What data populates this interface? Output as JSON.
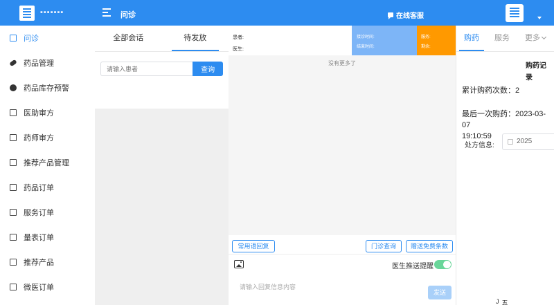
{
  "header": {
    "brand": "▪▪▪▪▪▪▪",
    "page_title": "问诊",
    "online_service": "在线客服"
  },
  "sidebar": {
    "items": [
      {
        "label": "问诊",
        "icon": "consult-icon",
        "active": true
      },
      {
        "label": "药品管理",
        "icon": "pill-icon"
      },
      {
        "label": "药品库存预警",
        "icon": "alert-icon"
      },
      {
        "label": "医助审方",
        "icon": "phone-icon"
      },
      {
        "label": "药师审方",
        "icon": "document-icon"
      },
      {
        "label": "推荐产品管理",
        "icon": "folder-icon"
      },
      {
        "label": "药品订单",
        "icon": "order-icon"
      },
      {
        "label": "服务订单",
        "icon": "service-order-icon"
      },
      {
        "label": "量表订单",
        "icon": "scale-order-icon"
      },
      {
        "label": "推荐产品",
        "icon": "product-icon"
      },
      {
        "label": "微医订单",
        "icon": "plus-order-icon"
      }
    ]
  },
  "conversations": {
    "tabs": [
      "全部会话",
      "待发放"
    ],
    "search_placeholder": "请输入患者",
    "search_button": "查询"
  },
  "chat": {
    "patient_label": "患者:",
    "doctor_label": "医生:",
    "start_time_label": "接诊时间:",
    "end_time_label": "结束时间:",
    "service_label": "服务:",
    "remaining_label": "剩余:",
    "no_more": "没有更多了",
    "quick_reply": "常用语回复",
    "outpatient_query": "门诊查询",
    "gift_free": "赠送免费条数",
    "push_reminder": "医生推送提醒",
    "reply_placeholder": "请输入回复信息内容",
    "send": "发送"
  },
  "right_panel": {
    "tabs": [
      "购药",
      "服务",
      "更多"
    ],
    "record_title": "购药记录",
    "total_count_label": "累计购药次数：",
    "total_count": "2",
    "last_purchase_label": "最后一次购药：",
    "last_purchase_date": "2023-03-07",
    "last_purchase_time": "19:10:59",
    "rx_label": "处方信息:",
    "rx_year": "2025"
  },
  "tools": {
    "tool_a": "J",
    "tool_b": "五"
  },
  "colors": {
    "primary": "#2d8cf0",
    "info_blue": "#7db5f7",
    "warning": "#ff9900",
    "switch_on": "#6ad69a"
  }
}
